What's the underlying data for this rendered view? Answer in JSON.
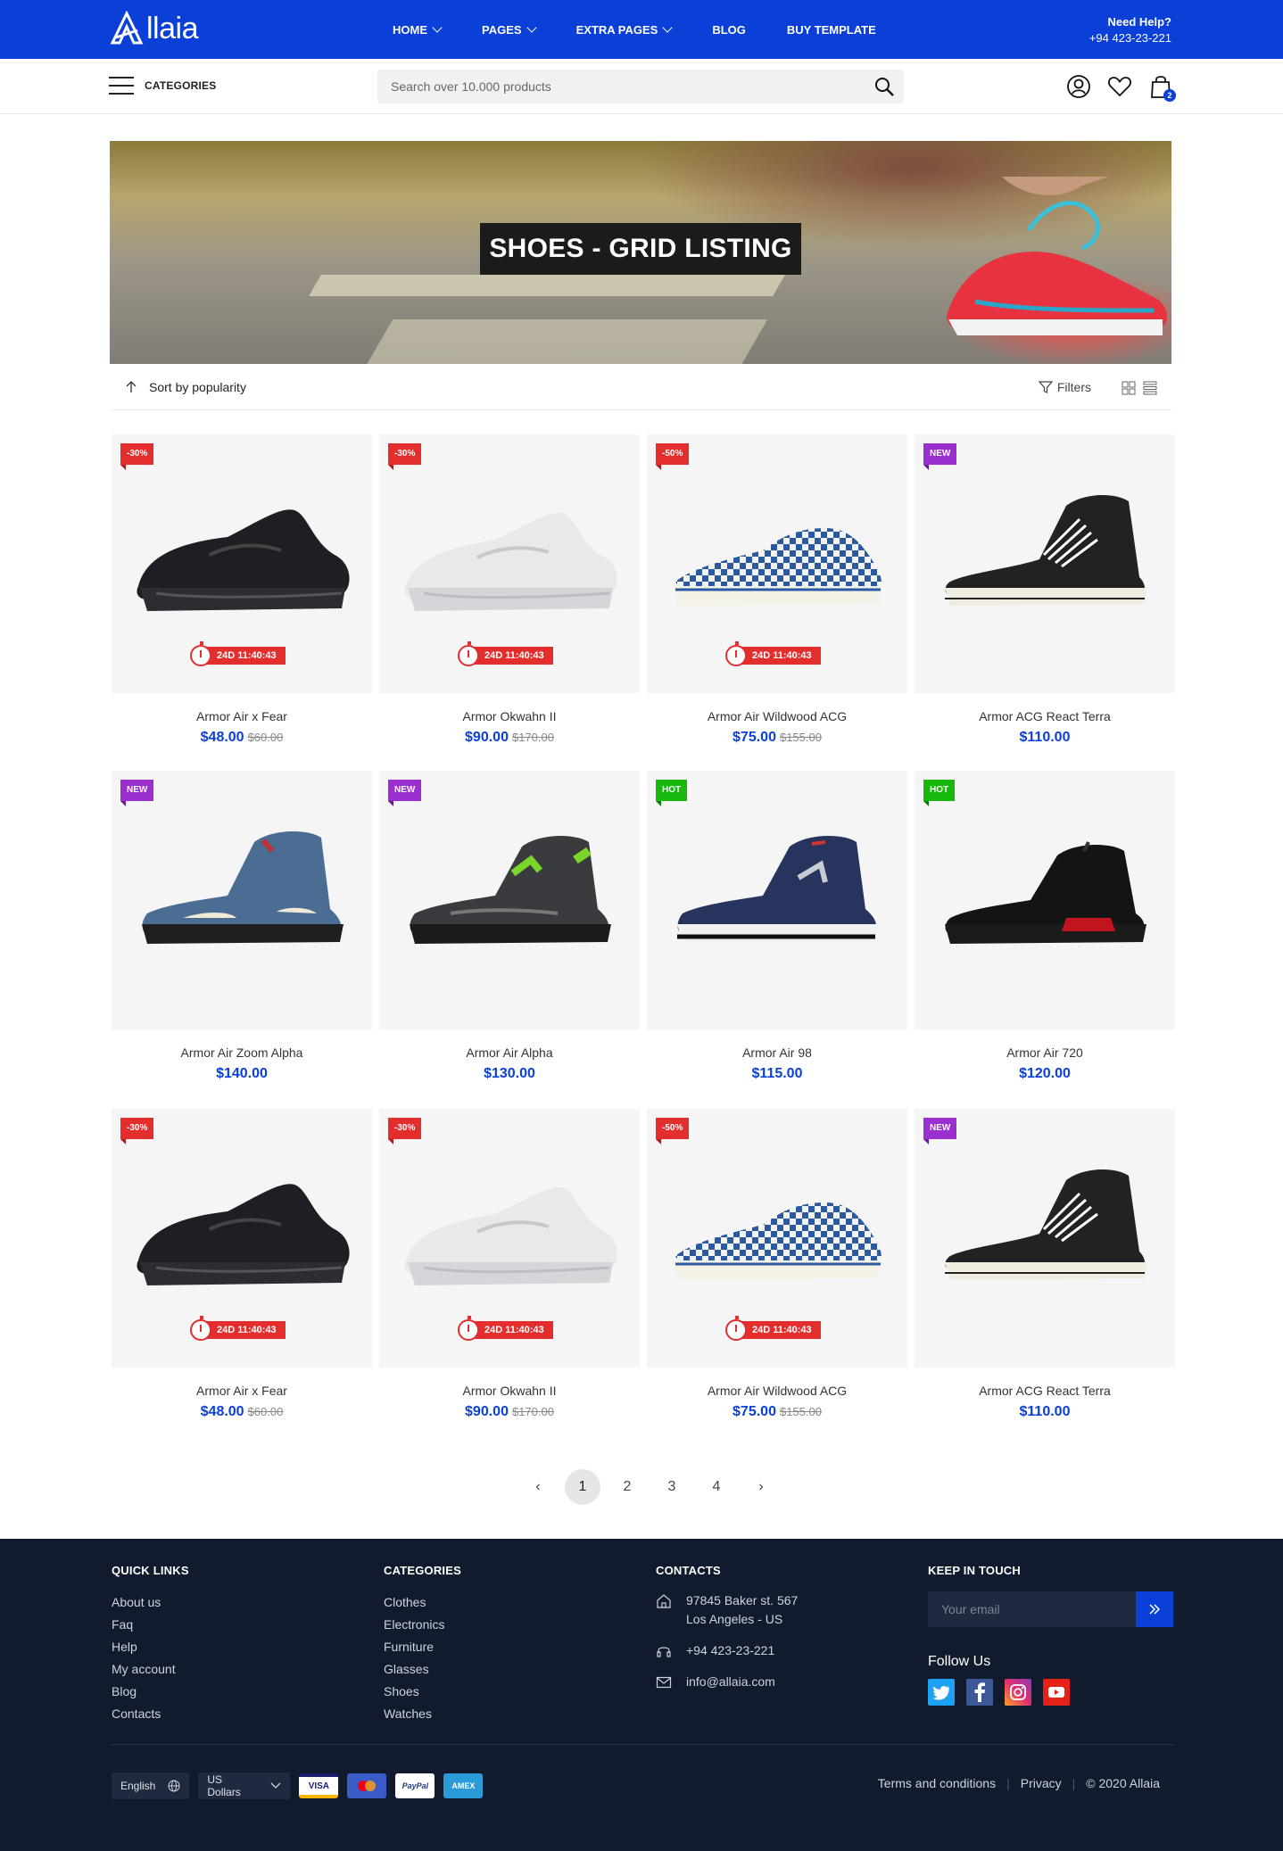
{
  "header": {
    "logo_text": "llaia",
    "nav": [
      {
        "label": "HOME",
        "dropdown": true
      },
      {
        "label": "PAGES",
        "dropdown": true
      },
      {
        "label": "EXTRA PAGES",
        "dropdown": true
      },
      {
        "label": "BLOG",
        "dropdown": false
      },
      {
        "label": "BUY TEMPLATE",
        "dropdown": false
      }
    ],
    "help_title": "Need Help?",
    "help_phone": "+94 423-23-221",
    "categories_label": "CATEGORIES",
    "search_placeholder": "Search over 10.000 products",
    "cart_count": "2"
  },
  "hero": {
    "title": "SHOES - GRID LISTING"
  },
  "toolbar": {
    "sort_label": "Sort by popularity",
    "filters_label": "Filters"
  },
  "products": [
    {
      "name": "Armor Air x Fear",
      "price": "$48.00",
      "old_price": "$60.00",
      "badge": "-30%",
      "badge_type": "red",
      "timer": "24D 11:40:43",
      "shoe": "black-runner"
    },
    {
      "name": "Armor Okwahn II",
      "price": "$90.00",
      "old_price": "$170.00",
      "badge": "-30%",
      "badge_type": "red",
      "timer": "24D 11:40:43",
      "shoe": "white-runner"
    },
    {
      "name": "Armor Air Wildwood ACG",
      "price": "$75.00",
      "old_price": "$155.00",
      "badge": "-50%",
      "badge_type": "red",
      "timer": "24D 11:40:43",
      "shoe": "checker"
    },
    {
      "name": "Armor ACG React Terra",
      "price": "$110.00",
      "old_price": "",
      "badge": "NEW",
      "badge_type": "purple",
      "timer": "",
      "shoe": "hightop"
    },
    {
      "name": "Armor Air Zoom Alpha",
      "price": "$140.00",
      "old_price": "",
      "badge": "NEW",
      "badge_type": "purple",
      "timer": "",
      "shoe": "denim-jordan"
    },
    {
      "name": "Armor Air Alpha",
      "price": "$130.00",
      "old_price": "",
      "badge": "NEW",
      "badge_type": "purple",
      "timer": "",
      "shoe": "grey-green"
    },
    {
      "name": "Armor Air 98",
      "price": "$115.00",
      "old_price": "",
      "badge": "HOT",
      "badge_type": "green",
      "timer": "",
      "shoe": "navy-jordan"
    },
    {
      "name": "Armor Air 720",
      "price": "$120.00",
      "old_price": "",
      "badge": "HOT",
      "badge_type": "green",
      "timer": "",
      "shoe": "black-red"
    },
    {
      "name": "Armor Air x Fear",
      "price": "$48.00",
      "old_price": "$60.00",
      "badge": "-30%",
      "badge_type": "red",
      "timer": "24D 11:40:43",
      "shoe": "black-runner"
    },
    {
      "name": "Armor Okwahn II",
      "price": "$90.00",
      "old_price": "$170.00",
      "badge": "-30%",
      "badge_type": "red",
      "timer": "24D 11:40:43",
      "shoe": "white-runner"
    },
    {
      "name": "Armor Air Wildwood ACG",
      "price": "$75.00",
      "old_price": "$155.00",
      "badge": "-50%",
      "badge_type": "red",
      "timer": "24D 11:40:43",
      "shoe": "checker"
    },
    {
      "name": "Armor ACG React Terra",
      "price": "$110.00",
      "old_price": "",
      "badge": "NEW",
      "badge_type": "purple",
      "timer": "",
      "shoe": "hightop"
    }
  ],
  "pagination": {
    "prev": "‹",
    "pages": [
      "1",
      "2",
      "3",
      "4"
    ],
    "current": "1",
    "next": "›"
  },
  "footer": {
    "quick_links_title": "QUICK LINKS",
    "quick_links": [
      "About us",
      "Faq",
      "Help",
      "My account",
      "Blog",
      "Contacts"
    ],
    "categories_title": "CATEGORIES",
    "categories": [
      "Clothes",
      "Electronics",
      "Furniture",
      "Glasses",
      "Shoes",
      "Watches"
    ],
    "contacts_title": "CONTACTS",
    "address_line1": "97845 Baker st. 567",
    "address_line2": "Los Angeles - US",
    "phone": "+94 423-23-221",
    "email": "info@allaia.com",
    "keep_title": "KEEP IN TOUCH",
    "email_placeholder": "Your email",
    "follow_title": "Follow Us",
    "language": "English",
    "currency": "US Dollars",
    "payments": [
      "VISA",
      "mastercard",
      "PayPal",
      "AMEX"
    ],
    "terms": "Terms and conditions",
    "privacy": "Privacy",
    "copyright": "© 2020 Allaia"
  },
  "colors": {
    "brand_blue": "#0a3fd8",
    "sale_red": "#e42e2e",
    "new_purple": "#9b2ecf",
    "hot_green": "#16b80b",
    "footer_bg": "#121a2e"
  }
}
